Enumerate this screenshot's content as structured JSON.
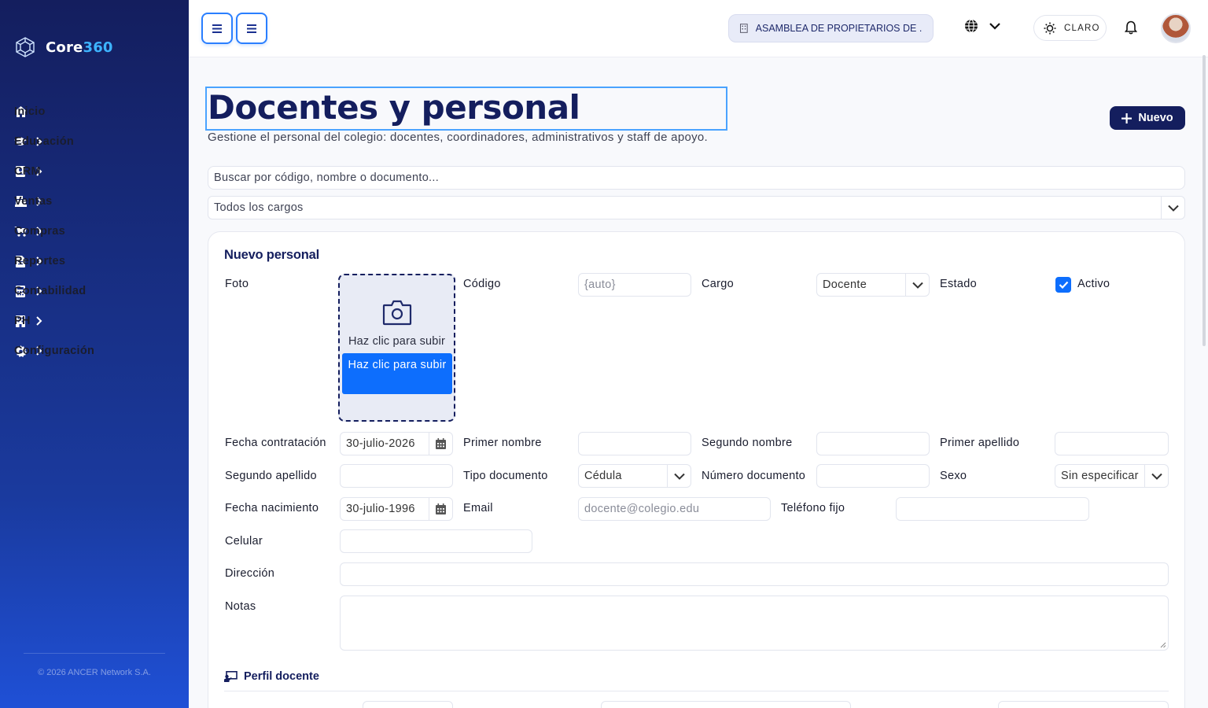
{
  "app": {
    "logo_prefix": "Core",
    "logo_suffix": "360",
    "copyright": "© 2026 ANCER Network S.A."
  },
  "sidebar": {
    "items": [
      {
        "label": "Inicio",
        "icon": "home-icon"
      },
      {
        "label": "Educación",
        "icon": "graduation-cap-icon"
      },
      {
        "label": "CRM",
        "icon": "address-book-icon"
      },
      {
        "label": "Ventas",
        "icon": "cash-register-icon"
      },
      {
        "label": "Compras",
        "icon": "cart-icon"
      },
      {
        "label": "Reportes",
        "icon": "file-icon"
      },
      {
        "label": "Contabilidad",
        "icon": "calculator-icon"
      },
      {
        "label": "PH",
        "icon": "building-icon"
      },
      {
        "label": "Configuración",
        "icon": "gear-icon"
      }
    ]
  },
  "topbar": {
    "organization": "ASAMBLEA DE PROPIETARIOS DE ...",
    "theme_label": "CLARO"
  },
  "page": {
    "title": "Docentes y personal",
    "subtitle": "Gestione el personal del colegio: docentes, coordinadores, administrativos y staff de apoyo.",
    "new_button": "Nuevo",
    "search_placeholder": "Buscar por código, nombre o documento...",
    "filter_value": "Todos los cargos"
  },
  "form": {
    "section_title": "Nuevo personal",
    "foto_label": "Foto",
    "upload_text": "Haz clic para subir",
    "upload_button": "Haz clic para subir",
    "codigo_label": "Código",
    "codigo_placeholder": "{auto}",
    "cargo_label": "Cargo",
    "cargo_value": "Docente",
    "estado_label": "Estado",
    "estado_checkbox_label": "Activo",
    "estado_checked": true,
    "fecha_contratacion_label": "Fecha contratación",
    "fecha_contratacion_value": "30-julio-2026",
    "primer_nombre_label": "Primer nombre",
    "segundo_nombre_label": "Segundo nombre",
    "primer_apellido_label": "Primer apellido",
    "segundo_apellido_label": "Segundo apellido",
    "tipo_documento_label": "Tipo documento",
    "tipo_documento_value": "Cédula",
    "numero_documento_label": "Número documento",
    "sexo_label": "Sexo",
    "sexo_value": "Sin especificar",
    "fecha_nacimiento_label": "Fecha nacimiento",
    "fecha_nacimiento_value": "30-julio-1996",
    "email_label": "Email",
    "email_placeholder": "docente@colegio.edu",
    "telefono_label": "Teléfono fijo",
    "celular_label": "Celular",
    "direccion_label": "Dirección",
    "notas_label": "Notas",
    "perfil_section": "Perfil docente"
  },
  "colors": {
    "primary": "#141e5e",
    "accent": "#0d6efd",
    "logo_accent": "#3db3ff"
  }
}
